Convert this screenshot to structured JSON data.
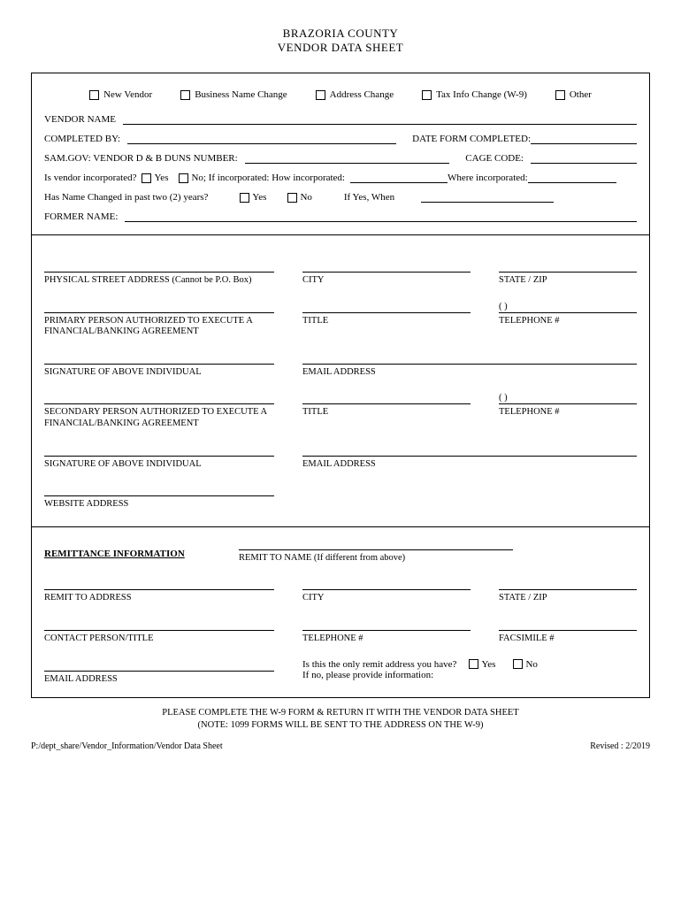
{
  "header": {
    "line1": "BRAZORIA COUNTY",
    "line2": "VENDOR DATA SHEET"
  },
  "topCheckboxes": {
    "newVendor": "New Vendor",
    "bizNameChange": "Business Name Change",
    "addressChange": "Address Change",
    "taxInfoChange": "Tax Info Change (W-9)",
    "other": "Other"
  },
  "section1": {
    "vendorName": "VENDOR NAME",
    "completedBy": "COMPLETED BY:",
    "dateFormCompleted": "DATE FORM COMPLETED:",
    "duns": "SAM.GOV:  VENDOR D & B DUNS NUMBER:",
    "cageCode": "CAGE CODE:",
    "isIncorporated": "Is vendor incorporated?",
    "yes": "Yes",
    "no": "No; If incorporated:  How incorporated:",
    "whereIncorporated": "Where incorporated:",
    "nameChanged": "Has Name Changed in past two (2) years?",
    "yes2": "Yes",
    "no2": "No",
    "ifYesWhen": "If Yes, When",
    "formerName": "FORMER NAME:"
  },
  "section2": {
    "physicalAddress": "PHYSICAL STREET ADDRESS (Cannot be P.O. Box)",
    "city": "CITY",
    "stateZip": "STATE / ZIP",
    "primaryPerson": "PRIMARY PERSON AUTHORIZED TO EXECUTE A FINANCIAL/BANKING AGREEMENT",
    "title": "TITLE",
    "telephone": "TELEPHONE #",
    "parenBlank": "(            )",
    "signature": "SIGNATURE OF ABOVE INDIVIDUAL",
    "emailAddress": "EMAIL ADDRESS",
    "secondaryPerson": "SECONDARY PERSON AUTHORIZED TO EXECUTE A FINANCIAL/BANKING AGREEMENT",
    "websiteAddress": "WEBSITE ADDRESS"
  },
  "section3": {
    "remitTitle": "REMITTANCE INFORMATION",
    "remitToName": "REMIT TO NAME (If different from above)",
    "remitToAddress": "REMIT TO ADDRESS",
    "city": "CITY",
    "stateZip": "STATE / ZIP",
    "contactPerson": "CONTACT PERSON/TITLE",
    "telephone": "TELEPHONE #",
    "facsimile": "FACSIMILE #",
    "emailAddress": "EMAIL ADDRESS",
    "onlyRemitQ": "Is this the only remit address you have?",
    "yes": "Yes",
    "no": "No",
    "ifNoProvide": "If no, please provide information:"
  },
  "footer": {
    "line1": "PLEASE COMPLETE THE W-9 FORM & RETURN IT WITH THE VENDOR DATA SHEET",
    "line2": "(NOTE: 1099 FORMS WILL BE SENT TO THE ADDRESS ON THE W-9)",
    "pathLeft": "P:/dept_share/Vendor_Information/Vendor Data Sheet",
    "revised": "Revised : 2/2019"
  }
}
